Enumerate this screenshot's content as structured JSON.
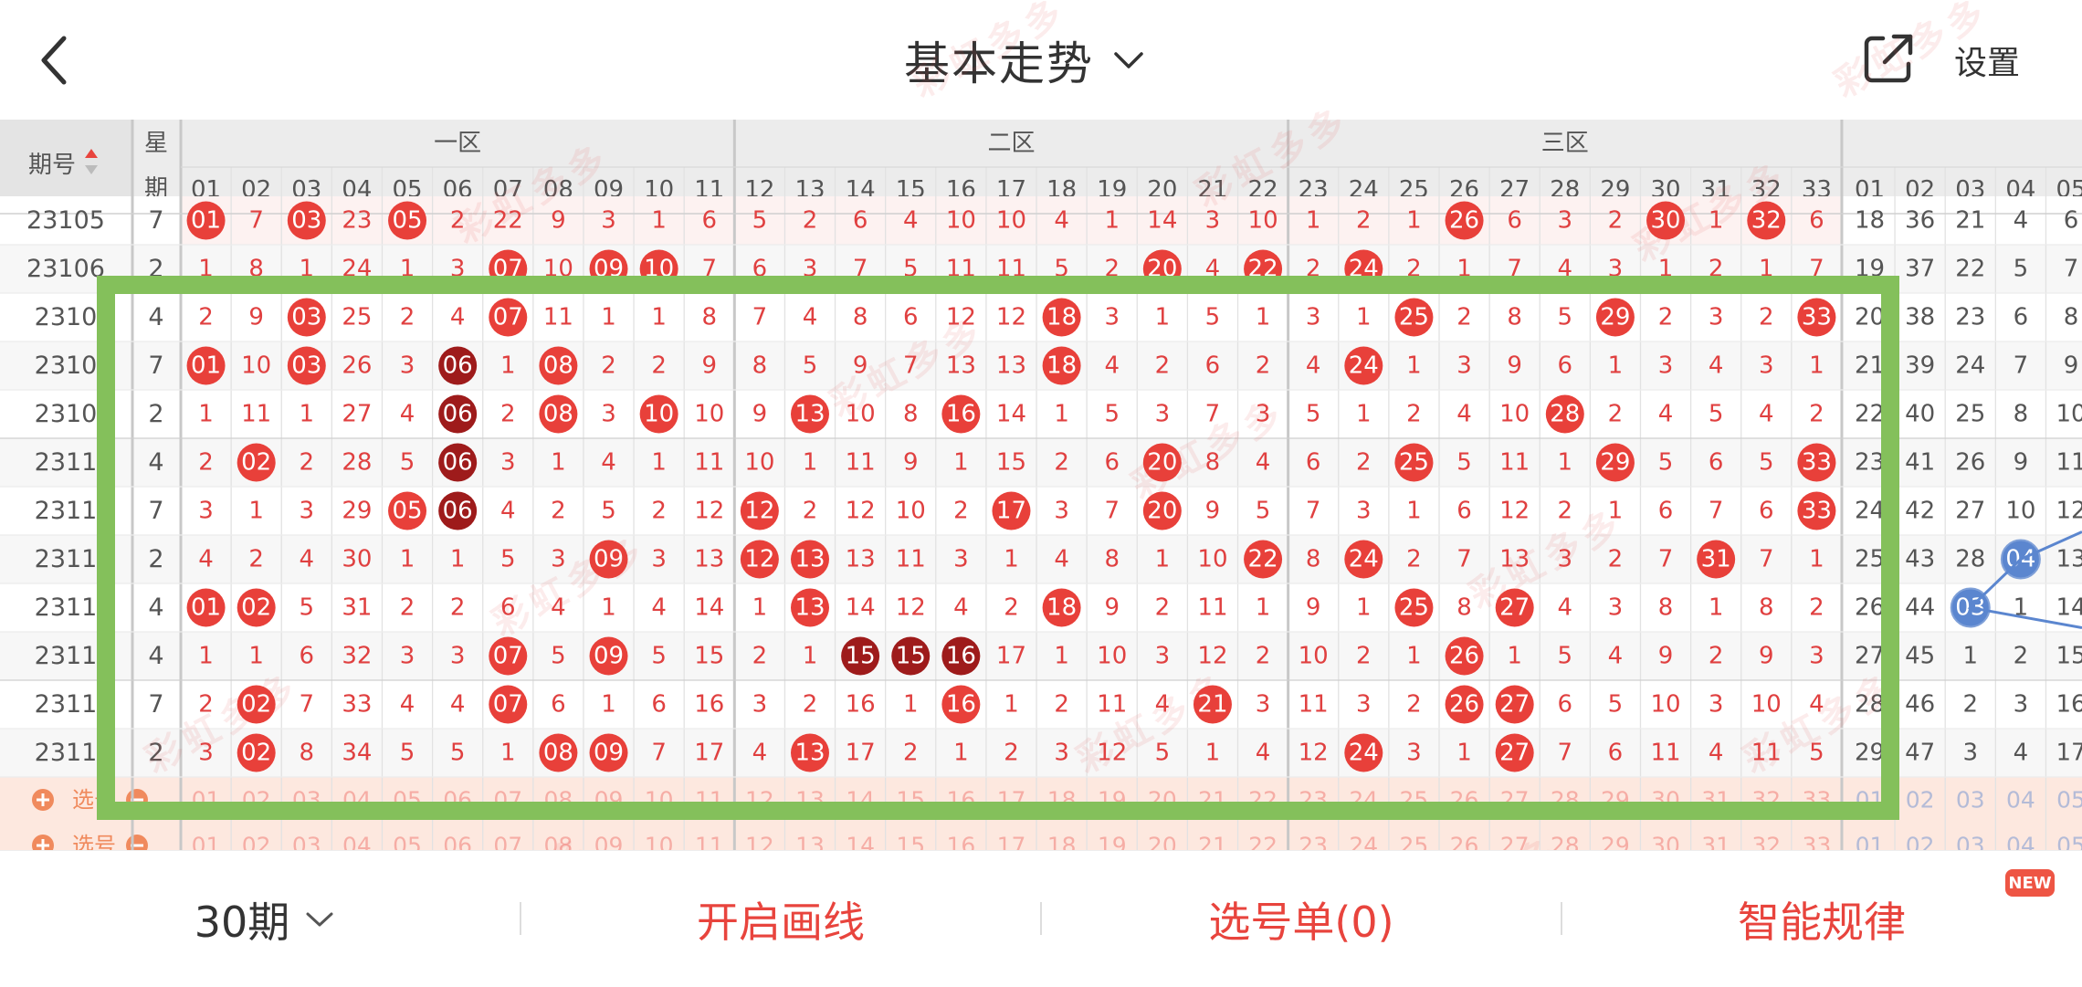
{
  "header": {
    "back_icon": "chevron-left-icon",
    "title": "基本走势",
    "title_caret_icon": "chevron-down-icon",
    "share_icon": "share-external-icon",
    "settings_label": "设置"
  },
  "colors": {
    "ball_red": "#e8403a",
    "ball_dark": "#9e1b1b",
    "ball_blue": "#5b86cf",
    "ball_text": "#ffffff",
    "cell_text": "#e04040",
    "period_text": "#555555",
    "header_bg": "#ececec",
    "frame_green": "#84c05b",
    "button_red": "#e8443d",
    "select_bg": "#fde8df"
  },
  "table": {
    "period_header": "期号",
    "sort_icon": "sort-updown-icon",
    "weekday_header": [
      "星",
      "期"
    ],
    "zones": [
      "一区",
      "二区",
      "三区"
    ],
    "main_columns": [
      "01",
      "02",
      "03",
      "04",
      "05",
      "06",
      "07",
      "08",
      "09",
      "10",
      "11",
      "12",
      "13",
      "14",
      "15",
      "16",
      "17",
      "18",
      "19",
      "20",
      "21",
      "22",
      "23",
      "24",
      "25",
      "26",
      "27",
      "28",
      "29",
      "30",
      "31",
      "32",
      "33"
    ],
    "blue_columns": [
      "01",
      "02",
      "03",
      "04",
      "05"
    ],
    "rows": [
      {
        "period": "23105",
        "weekday": "7",
        "cells": [
          "01",
          "7",
          "03",
          "23",
          "05",
          "2",
          "22",
          "9",
          "3",
          "1",
          "6",
          "5",
          "2",
          "6",
          "4",
          "10",
          "10",
          "4",
          "1",
          "14",
          "3",
          "10",
          "1",
          "2",
          "1",
          "26",
          "6",
          "3",
          "2",
          "30",
          "1",
          "32",
          "6"
        ],
        "blue": [
          "18",
          "36",
          "21",
          "4",
          "6"
        ]
      },
      {
        "period": "23106",
        "weekday": "2",
        "cells": [
          "1",
          "8",
          "1",
          "24",
          "1",
          "3",
          "07",
          "10",
          "09",
          "10",
          "7",
          "6",
          "3",
          "7",
          "5",
          "11",
          "11",
          "5",
          "2",
          "20",
          "4",
          "22",
          "2",
          "24",
          "2",
          "1",
          "7",
          "4",
          "3",
          "1",
          "2",
          "1",
          "7"
        ],
        "blue": [
          "19",
          "37",
          "22",
          "5",
          "7"
        ]
      },
      {
        "period": "2310",
        "weekday": "4",
        "cells": [
          "2",
          "9",
          "03",
          "25",
          "2",
          "4",
          "07",
          "11",
          "1",
          "1",
          "8",
          "7",
          "4",
          "8",
          "6",
          "12",
          "12",
          "18",
          "3",
          "1",
          "5",
          "1",
          "3",
          "1",
          "25",
          "2",
          "8",
          "5",
          "29",
          "2",
          "3",
          "2",
          "33"
        ],
        "blue": [
          "20",
          "38",
          "23",
          "6",
          "8"
        ]
      },
      {
        "period": "2310",
        "weekday": "7",
        "cells": [
          "01",
          "10",
          "03",
          "26",
          "3",
          "06",
          "1",
          "08",
          "2",
          "2",
          "9",
          "8",
          "5",
          "9",
          "7",
          "13",
          "13",
          "18",
          "4",
          "2",
          "6",
          "2",
          "4",
          "24",
          "1",
          "3",
          "9",
          "6",
          "1",
          "3",
          "4",
          "3",
          "1"
        ],
        "blue": [
          "21",
          "39",
          "24",
          "7",
          "9"
        ]
      },
      {
        "period": "2310",
        "weekday": "2",
        "cells": [
          "1",
          "11",
          "1",
          "27",
          "4",
          "06",
          "2",
          "08",
          "3",
          "10",
          "10",
          "9",
          "13",
          "10",
          "8",
          "16",
          "14",
          "1",
          "5",
          "3",
          "7",
          "3",
          "5",
          "1",
          "2",
          "4",
          "10",
          "28",
          "2",
          "4",
          "5",
          "4",
          "2"
        ],
        "blue": [
          "22",
          "40",
          "25",
          "8",
          "10"
        ]
      },
      {
        "period": "2311",
        "weekday": "4",
        "cells": [
          "2",
          "02",
          "2",
          "28",
          "5",
          "06",
          "3",
          "1",
          "4",
          "1",
          "11",
          "10",
          "1",
          "11",
          "9",
          "1",
          "15",
          "2",
          "6",
          "20",
          "8",
          "4",
          "6",
          "2",
          "25",
          "5",
          "11",
          "1",
          "29",
          "5",
          "6",
          "5",
          "33"
        ],
        "blue": [
          "23",
          "41",
          "26",
          "9",
          "11"
        ]
      },
      {
        "period": "2311",
        "weekday": "7",
        "cells": [
          "3",
          "1",
          "3",
          "29",
          "05",
          "06",
          "4",
          "2",
          "5",
          "2",
          "12",
          "12",
          "2",
          "12",
          "10",
          "2",
          "17",
          "3",
          "7",
          "20",
          "9",
          "5",
          "7",
          "3",
          "1",
          "6",
          "12",
          "2",
          "1",
          "6",
          "7",
          "6",
          "33"
        ],
        "blue": [
          "24",
          "42",
          "27",
          "10",
          "12"
        ]
      },
      {
        "period": "2311",
        "weekday": "2",
        "cells": [
          "4",
          "2",
          "4",
          "30",
          "1",
          "1",
          "5",
          "3",
          "09",
          "3",
          "13",
          "12",
          "13",
          "13",
          "11",
          "3",
          "1",
          "4",
          "8",
          "1",
          "10",
          "22",
          "8",
          "24",
          "2",
          "7",
          "13",
          "3",
          "2",
          "7",
          "31",
          "7",
          "1"
        ],
        "blue": [
          "25",
          "43",
          "28",
          "04",
          "13"
        ]
      },
      {
        "period": "2311",
        "weekday": "4",
        "cells": [
          "01",
          "02",
          "5",
          "31",
          "2",
          "2",
          "6",
          "4",
          "1",
          "4",
          "14",
          "1",
          "13",
          "14",
          "12",
          "4",
          "2",
          "18",
          "9",
          "2",
          "11",
          "1",
          "9",
          "1",
          "25",
          "8",
          "27",
          "4",
          "3",
          "8",
          "1",
          "8",
          "2"
        ],
        "blue": [
          "26",
          "44",
          "03",
          "1",
          "14"
        ]
      },
      {
        "period": "2311",
        "weekday": "4",
        "cells": [
          "1",
          "1",
          "6",
          "32",
          "3",
          "3",
          "07",
          "5",
          "09",
          "5",
          "15",
          "2",
          "1",
          "15",
          "15",
          "16",
          "17",
          "1",
          "10",
          "3",
          "12",
          "2",
          "10",
          "2",
          "1",
          "26",
          "1",
          "5",
          "4",
          "9",
          "2",
          "9",
          "3"
        ],
        "blue": [
          "27",
          "45",
          "1",
          "2",
          "15"
        ]
      },
      {
        "period": "2311",
        "weekday": "7",
        "cells": [
          "2",
          "02",
          "7",
          "33",
          "4",
          "4",
          "07",
          "6",
          "1",
          "6",
          "16",
          "3",
          "2",
          "16",
          "1",
          "16",
          "1",
          "2",
          "11",
          "4",
          "21",
          "3",
          "11",
          "3",
          "2",
          "26",
          "27",
          "6",
          "5",
          "10",
          "3",
          "10",
          "4"
        ],
        "blue": [
          "28",
          "46",
          "2",
          "3",
          "16"
        ]
      },
      {
        "period": "2311",
        "weekday": "2",
        "cells": [
          "3",
          "02",
          "8",
          "34",
          "5",
          "5",
          "1",
          "08",
          "09",
          "7",
          "17",
          "4",
          "13",
          "17",
          "2",
          "1",
          "2",
          "3",
          "12",
          "5",
          "1",
          "4",
          "12",
          "24",
          "3",
          "1",
          "27",
          "7",
          "6",
          "11",
          "4",
          "11",
          "5"
        ],
        "blue": [
          "29",
          "47",
          "3",
          "4",
          "17"
        ]
      }
    ],
    "red_balls": [
      [
        0,
        0
      ],
      [
        0,
        2
      ],
      [
        0,
        4
      ],
      [
        0,
        25
      ],
      [
        0,
        29
      ],
      [
        0,
        31
      ],
      [
        1,
        6
      ],
      [
        1,
        8
      ],
      [
        1,
        9
      ],
      [
        1,
        19
      ],
      [
        1,
        21
      ],
      [
        1,
        23
      ],
      [
        2,
        2
      ],
      [
        2,
        6
      ],
      [
        2,
        17
      ],
      [
        2,
        24
      ],
      [
        2,
        28
      ],
      [
        2,
        32
      ],
      [
        3,
        0
      ],
      [
        3,
        2
      ],
      [
        3,
        7
      ],
      [
        3,
        17
      ],
      [
        3,
        23
      ],
      [
        4,
        7
      ],
      [
        4,
        9
      ],
      [
        4,
        12
      ],
      [
        4,
        15
      ],
      [
        4,
        27
      ],
      [
        5,
        1
      ],
      [
        5,
        19
      ],
      [
        5,
        24
      ],
      [
        5,
        28
      ],
      [
        5,
        32
      ],
      [
        6,
        4
      ],
      [
        6,
        11
      ],
      [
        6,
        16
      ],
      [
        6,
        19
      ],
      [
        6,
        32
      ],
      [
        7,
        8
      ],
      [
        7,
        11
      ],
      [
        7,
        12
      ],
      [
        7,
        21
      ],
      [
        7,
        23
      ],
      [
        7,
        30
      ],
      [
        8,
        0
      ],
      [
        8,
        1
      ],
      [
        8,
        12
      ],
      [
        8,
        17
      ],
      [
        8,
        24
      ],
      [
        8,
        26
      ],
      [
        9,
        6
      ],
      [
        9,
        8
      ],
      [
        9,
        25
      ],
      [
        10,
        1
      ],
      [
        10,
        6
      ],
      [
        10,
        15
      ],
      [
        10,
        20
      ],
      [
        10,
        25
      ],
      [
        10,
        26
      ],
      [
        11,
        1
      ],
      [
        11,
        7
      ],
      [
        11,
        8
      ],
      [
        11,
        12
      ],
      [
        11,
        23
      ],
      [
        11,
        26
      ]
    ],
    "dark_balls": [
      [
        3,
        5
      ],
      [
        4,
        5
      ],
      [
        5,
        5
      ],
      [
        6,
        5
      ],
      [
        9,
        13
      ],
      [
        9,
        14
      ],
      [
        9,
        15
      ]
    ],
    "blue_balls": [
      [
        7,
        3
      ],
      [
        8,
        2
      ]
    ],
    "select_rows": [
      {
        "label": "选号",
        "add_icon": "plus-circle-icon",
        "remove_icon": "minus-circle-icon"
      },
      {
        "label": "选号",
        "add_icon": "plus-circle-icon",
        "remove_icon": "minus-circle-icon"
      }
    ]
  },
  "watermark_text": "彩虹多多",
  "bottom_bar": {
    "period_label": "30期",
    "period_caret_icon": "chevron-down-icon",
    "draw_line_label": "开启画线",
    "selection_label": "选号单(0)",
    "smart_label": "智能规律",
    "new_badge": "NEW"
  }
}
